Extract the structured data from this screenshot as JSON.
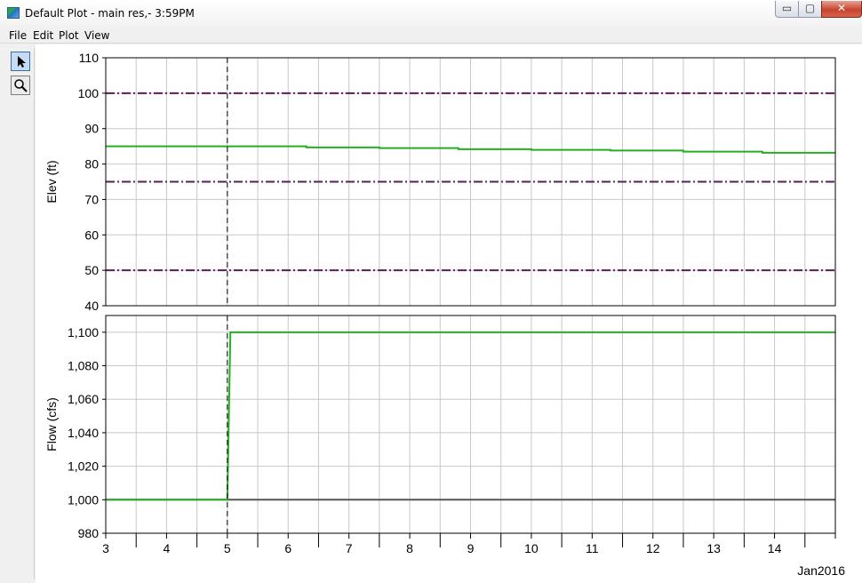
{
  "window": {
    "title": "Default Plot - main res,- 3:59PM",
    "minimize_glyph": "▭",
    "maximize_glyph": "▢",
    "close_glyph": "✕"
  },
  "menu": {
    "items": [
      {
        "label": "File"
      },
      {
        "label": "Edit"
      },
      {
        "label": "Plot"
      },
      {
        "label": "View"
      }
    ]
  },
  "toolbar": {
    "tools": [
      {
        "name": "select-tool",
        "icon": "arrow-cursor-icon",
        "active": true
      },
      {
        "name": "zoom-tool",
        "icon": "magnifier-icon",
        "active": false
      }
    ]
  },
  "colors": {
    "series_green": "#22b022",
    "series_gray": "#555555",
    "reference_line": "#5a1d5a",
    "grid": "#c8c8c8",
    "marker_line": "#000000"
  },
  "chart_data": [
    {
      "type": "line",
      "ylabel": "Elev (ft)",
      "xlabel": "",
      "ylim": [
        40,
        110
      ],
      "y_ticks": [
        40,
        50,
        60,
        70,
        80,
        90,
        100,
        110
      ],
      "xlim": [
        3,
        15
      ],
      "grid": true,
      "reference_lines": [
        100,
        75,
        50
      ],
      "vertical_marker_x": 5,
      "series": [
        {
          "color_key": "series_green",
          "x": [
            3,
            6.3,
            6.3,
            7.5,
            7.5,
            8.8,
            8.8,
            10,
            10,
            11.3,
            11.3,
            12.5,
            12.5,
            13.8,
            13.8,
            15
          ],
          "y": [
            85,
            85,
            84.7,
            84.7,
            84.5,
            84.5,
            84.2,
            84.2,
            84.0,
            84.0,
            83.8,
            83.8,
            83.5,
            83.5,
            83.2,
            83.2
          ]
        }
      ]
    },
    {
      "type": "line",
      "ylabel": "Flow (cfs)",
      "xlabel": "",
      "ylim": [
        980,
        1110
      ],
      "y_ticks": [
        980,
        1000,
        1020,
        1040,
        1060,
        1080,
        1100
      ],
      "y_tick_labels": [
        "980",
        "1,000",
        "1,020",
        "1,040",
        "1,060",
        "1,080",
        "1,100"
      ],
      "xlim": [
        3,
        15
      ],
      "x_ticks": [
        3,
        4,
        5,
        6,
        7,
        8,
        9,
        10,
        11,
        12,
        13,
        14
      ],
      "x_tick_labels": [
        "3",
        "4",
        "5",
        "6",
        "7",
        "8",
        "9",
        "10",
        "11",
        "12",
        "13",
        "14"
      ],
      "x_axis_caption": "Jan2016",
      "grid": true,
      "vertical_marker_x": 5,
      "series": [
        {
          "color_key": "series_gray",
          "x": [
            3,
            15
          ],
          "y": [
            1000,
            1000
          ]
        },
        {
          "color_key": "series_green",
          "x": [
            3,
            5,
            5.05,
            15
          ],
          "y": [
            1000,
            1000,
            1100,
            1100
          ]
        }
      ]
    }
  ]
}
